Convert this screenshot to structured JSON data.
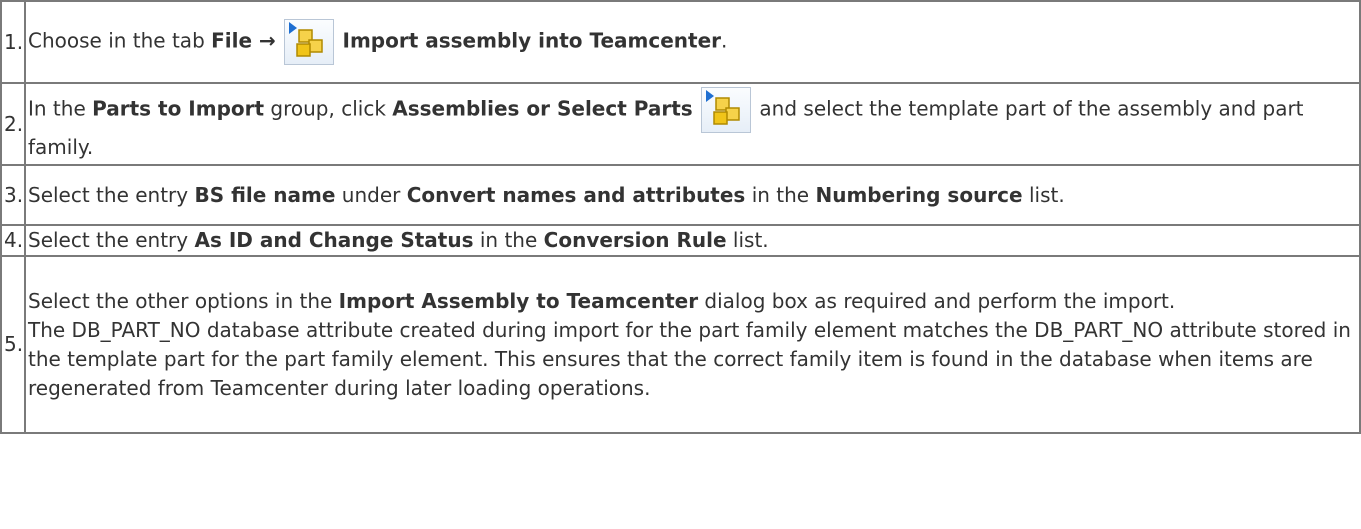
{
  "steps": [
    {
      "num": "1.",
      "t1": "Choose in the tab ",
      "b1": "File →",
      "b2": "Import assembly into Teamcenter",
      "t2": "."
    },
    {
      "num": "2.",
      "t1": "In the ",
      "b1": "Parts to Import",
      "t2": " group, click ",
      "b2": "Assemblies or Select Parts",
      "t3": " and select the template part of the assembly and part family."
    },
    {
      "num": "3.",
      "t1": "Select the entry ",
      "b1": "BS file name",
      "t2": " under ",
      "b2": "Convert names and attributes",
      "t3": " in the ",
      "b3": "Numbering source",
      "t4": " list."
    },
    {
      "num": "4.",
      "t1": "Select the entry ",
      "b1": "As ID and Change Status",
      "t2": " in the ",
      "b2": "Conversion Rule",
      "t3": " list."
    },
    {
      "num": "5.",
      "t1": "Select the other options in the ",
      "b1": "Import Assembly to Teamcenter",
      "t2": " dialog box as required and perform the import.",
      "p2": "The DB_PART_NO database attribute created during import for the part family element matches the DB_PART_NO attribute stored in the template part for the part family element. This ensures that the correct family item is found in the database when items are regenerated from Teamcenter during later loading operations."
    }
  ],
  "icons": {
    "import_assembly": "import-assembly-icon",
    "assemblies_select_parts": "assemblies-select-parts-icon"
  },
  "colors": {
    "border": "#7a7a7a",
    "text": "#333333",
    "icon_arrow": "#1f6fd1",
    "icon_box": "#f0c419"
  }
}
